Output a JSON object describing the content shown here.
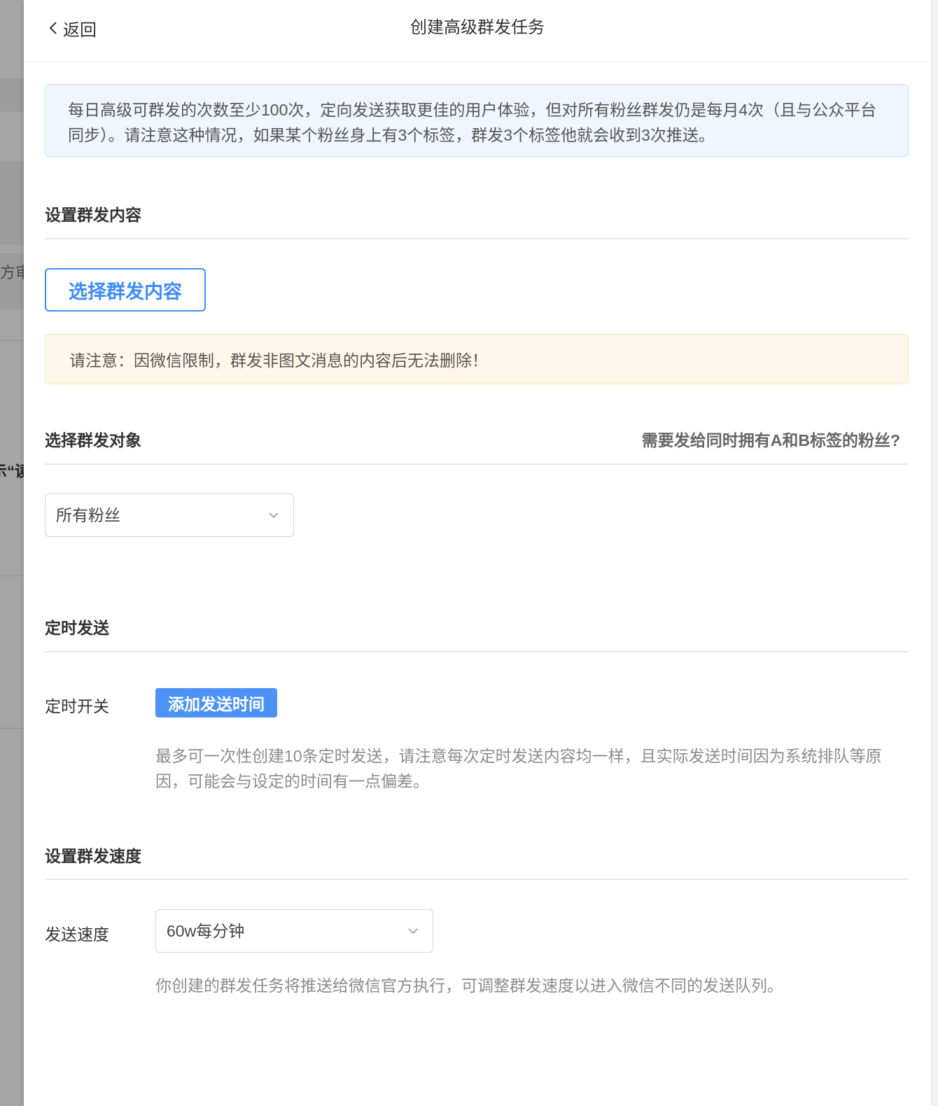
{
  "background": {
    "fragment_1": "方审",
    "fragment_2": "示“读"
  },
  "header": {
    "back_label": "返回",
    "title": "创建高级群发任务"
  },
  "notice": {
    "text": "每日高级可群发的次数至少100次，定向发送获取更佳的用户体验，但对所有粉丝群发仍是每月4次（且与公众平台同步）。请注意这种情况，如果某个粉丝身上有3个标签，群发3个标签他就会收到3次推送。"
  },
  "content_section": {
    "title": "设置群发内容",
    "select_button": "选择群发内容",
    "warning": "请注意：因微信限制，群发非图文消息的内容后无法删除！"
  },
  "target_section": {
    "title": "选择群发对象",
    "help_link": "需要发给同时拥有A和B标签的粉丝?",
    "selected": "所有粉丝"
  },
  "schedule_section": {
    "title": "定时发送",
    "switch_label": "定时开关",
    "add_time_button": "添加发送时间",
    "help": "最多可一次性创建10条定时发送，请注意每次定时发送内容均一样，且实际发送时间因为系统排队等原因，可能会与设定的时间有一点偏差。"
  },
  "speed_section": {
    "title": "设置群发速度",
    "speed_label": "发送速度",
    "speed_selected": "60w每分钟",
    "help": "你创建的群发任务将推送给微信官方执行，可调整群发速度以进入微信不同的发送队列。"
  },
  "colors": {
    "accent": "#3f8cf4",
    "info_bg": "#f0f6ff",
    "warn_bg": "#fff8ea",
    "overlay": "#a9a9a9"
  },
  "icons": {
    "back": "chevron-left-icon",
    "dropdown": "chevron-down-icon"
  }
}
